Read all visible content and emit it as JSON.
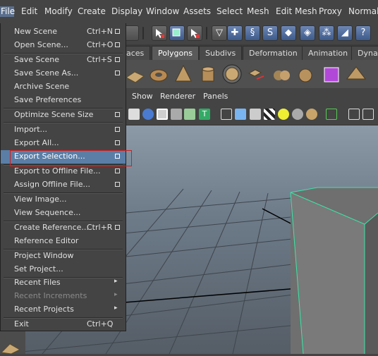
{
  "menubar": {
    "items": [
      "File",
      "Edit",
      "Modify",
      "Create",
      "Display",
      "Window",
      "Assets",
      "Select",
      "Mesh",
      "Edit Mesh",
      "Proxy",
      "Normals"
    ]
  },
  "shelf_tabs": [
    "aces",
    "Polygons",
    "Subdivs",
    "Deformation",
    "Animation",
    "Dynam"
  ],
  "panel_menu": [
    "Show",
    "Renderer",
    "Panels"
  ],
  "file_menu": {
    "items": [
      {
        "label": "New Scene",
        "shortcut": "Ctrl+N",
        "option": true
      },
      {
        "label": "Open Scene...",
        "shortcut": "Ctrl+O",
        "option": true
      },
      {
        "label": "Save Scene",
        "shortcut": "Ctrl+S",
        "option": true
      },
      {
        "label": "Save Scene As...",
        "shortcut": "",
        "option": true
      },
      {
        "label": "Archive Scene",
        "shortcut": "",
        "option": false
      },
      {
        "label": "Save Preferences",
        "shortcut": "",
        "option": false
      },
      {
        "label": "Optimize Scene Size",
        "shortcut": "",
        "option": true
      },
      {
        "label": "Import...",
        "shortcut": "",
        "option": true
      },
      {
        "label": "Export All...",
        "shortcut": "",
        "option": true
      },
      {
        "label": "Export Selection...",
        "shortcut": "",
        "option": true
      },
      {
        "label": "Export to Offline File...",
        "shortcut": "",
        "option": true
      },
      {
        "label": "Assign Offline File...",
        "shortcut": "",
        "option": true
      },
      {
        "label": "View Image...",
        "shortcut": "",
        "option": false
      },
      {
        "label": "View Sequence...",
        "shortcut": "",
        "option": false
      },
      {
        "label": "Create Reference...",
        "shortcut": "Ctrl+R",
        "option": true
      },
      {
        "label": "Reference Editor",
        "shortcut": "",
        "option": false
      },
      {
        "label": "Project Window",
        "shortcut": "",
        "option": false
      },
      {
        "label": "Set Project...",
        "shortcut": "",
        "option": false
      },
      {
        "label": "Recent Files",
        "shortcut": "",
        "submenu": true
      },
      {
        "label": "Recent Increments",
        "shortcut": "",
        "submenu": true,
        "disabled": true
      },
      {
        "label": "Recent Projects",
        "shortcut": "",
        "submenu": true
      },
      {
        "label": "Exit",
        "shortcut": "Ctrl+Q",
        "option": false
      }
    ],
    "highlighted": "Export Selection..."
  },
  "colors": {
    "menu_bg": "#444444",
    "highlight": "#5b7ea6",
    "selection_wire": "#39e6a8",
    "red_box": "#d41d1d"
  }
}
